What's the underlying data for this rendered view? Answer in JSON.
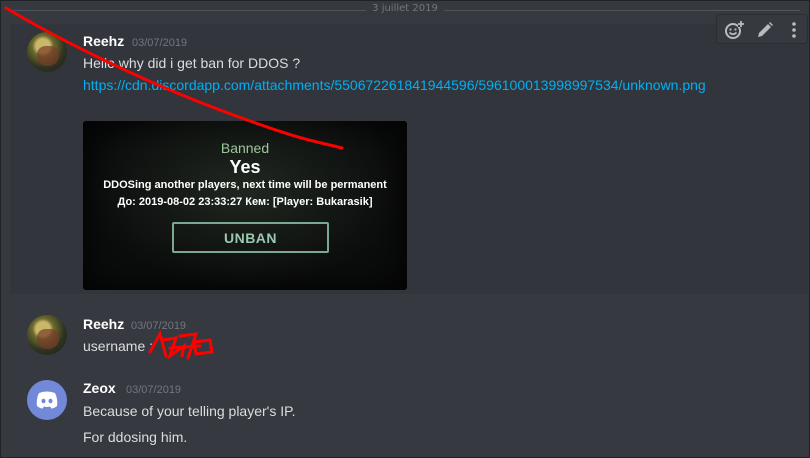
{
  "date_divider": "3 juillet 2019",
  "messages": [
    {
      "author": "Reehz",
      "timestamp": "03/07/2019",
      "text": "Hello why did i get ban for DDOS ?",
      "link": "https://cdn.discordapp.com/attachments/550672261841944596/596100013998997534/unknown.png",
      "embed": {
        "status": "Banned",
        "answer": "Yes",
        "reason": "DDOSing another players, next time will be permanent",
        "details": "До: 2019-08-02 23:33:27 Кем: [Player: Bukarasik]",
        "button": "UNBAN"
      }
    },
    {
      "author": "Reehz",
      "timestamp": "03/07/2019",
      "text": "username :"
    },
    {
      "author": "Zeox",
      "timestamp": "03/07/2019",
      "lines": [
        "Because of your telling player's IP.",
        "For ddosing him."
      ]
    }
  ],
  "toolbar_icons": [
    "add-reaction-icon",
    "edit-icon",
    "more-icon"
  ],
  "colors": {
    "background": "#36393f",
    "link": "#00b0f4",
    "annotation": "#ff0000",
    "blurple": "#7289da"
  }
}
